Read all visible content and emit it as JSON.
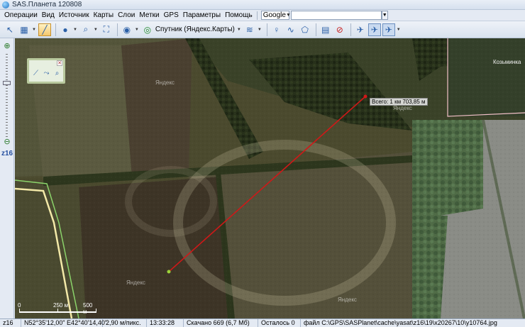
{
  "window": {
    "title": "SAS.Планета 120808"
  },
  "menu": {
    "items": [
      "Операции",
      "Вид",
      "Источник",
      "Карты",
      "Слои",
      "Метки",
      "GPS",
      "Параметры",
      "Помощь"
    ],
    "search_engine": "Google",
    "search_value": ""
  },
  "toolbar": {
    "map_selector_label": "Спутник (Яндекс.Карты)"
  },
  "zoom": {
    "level_label": "z16"
  },
  "map": {
    "watermark": "Яндекс",
    "village_label": "Козьминка",
    "distance_label": "Всего: 1 км 703,85 м",
    "scale": {
      "labels": [
        "0",
        "250 м",
        "500 м"
      ]
    }
  },
  "status": {
    "zoom": "z16",
    "coordinates": "N52°35'12,00\" E42°40'14,40\"",
    "resolution": "2,90 м/пикс.",
    "time": "13:33:28",
    "downloaded": "Скачано 669 (6,7 Мб)",
    "remaining": "Осталось 0",
    "file": "файл C:\\GPS\\SASPlanet\\cache\\yasat\\z16\\19\\x20267\\10\\y10764.jpg"
  },
  "colors": {
    "measure_line": "#d01818",
    "road_yellow": "#f3e9a8",
    "road_green": "#8bd36a",
    "boundary_pink": "#f2c0c8"
  }
}
